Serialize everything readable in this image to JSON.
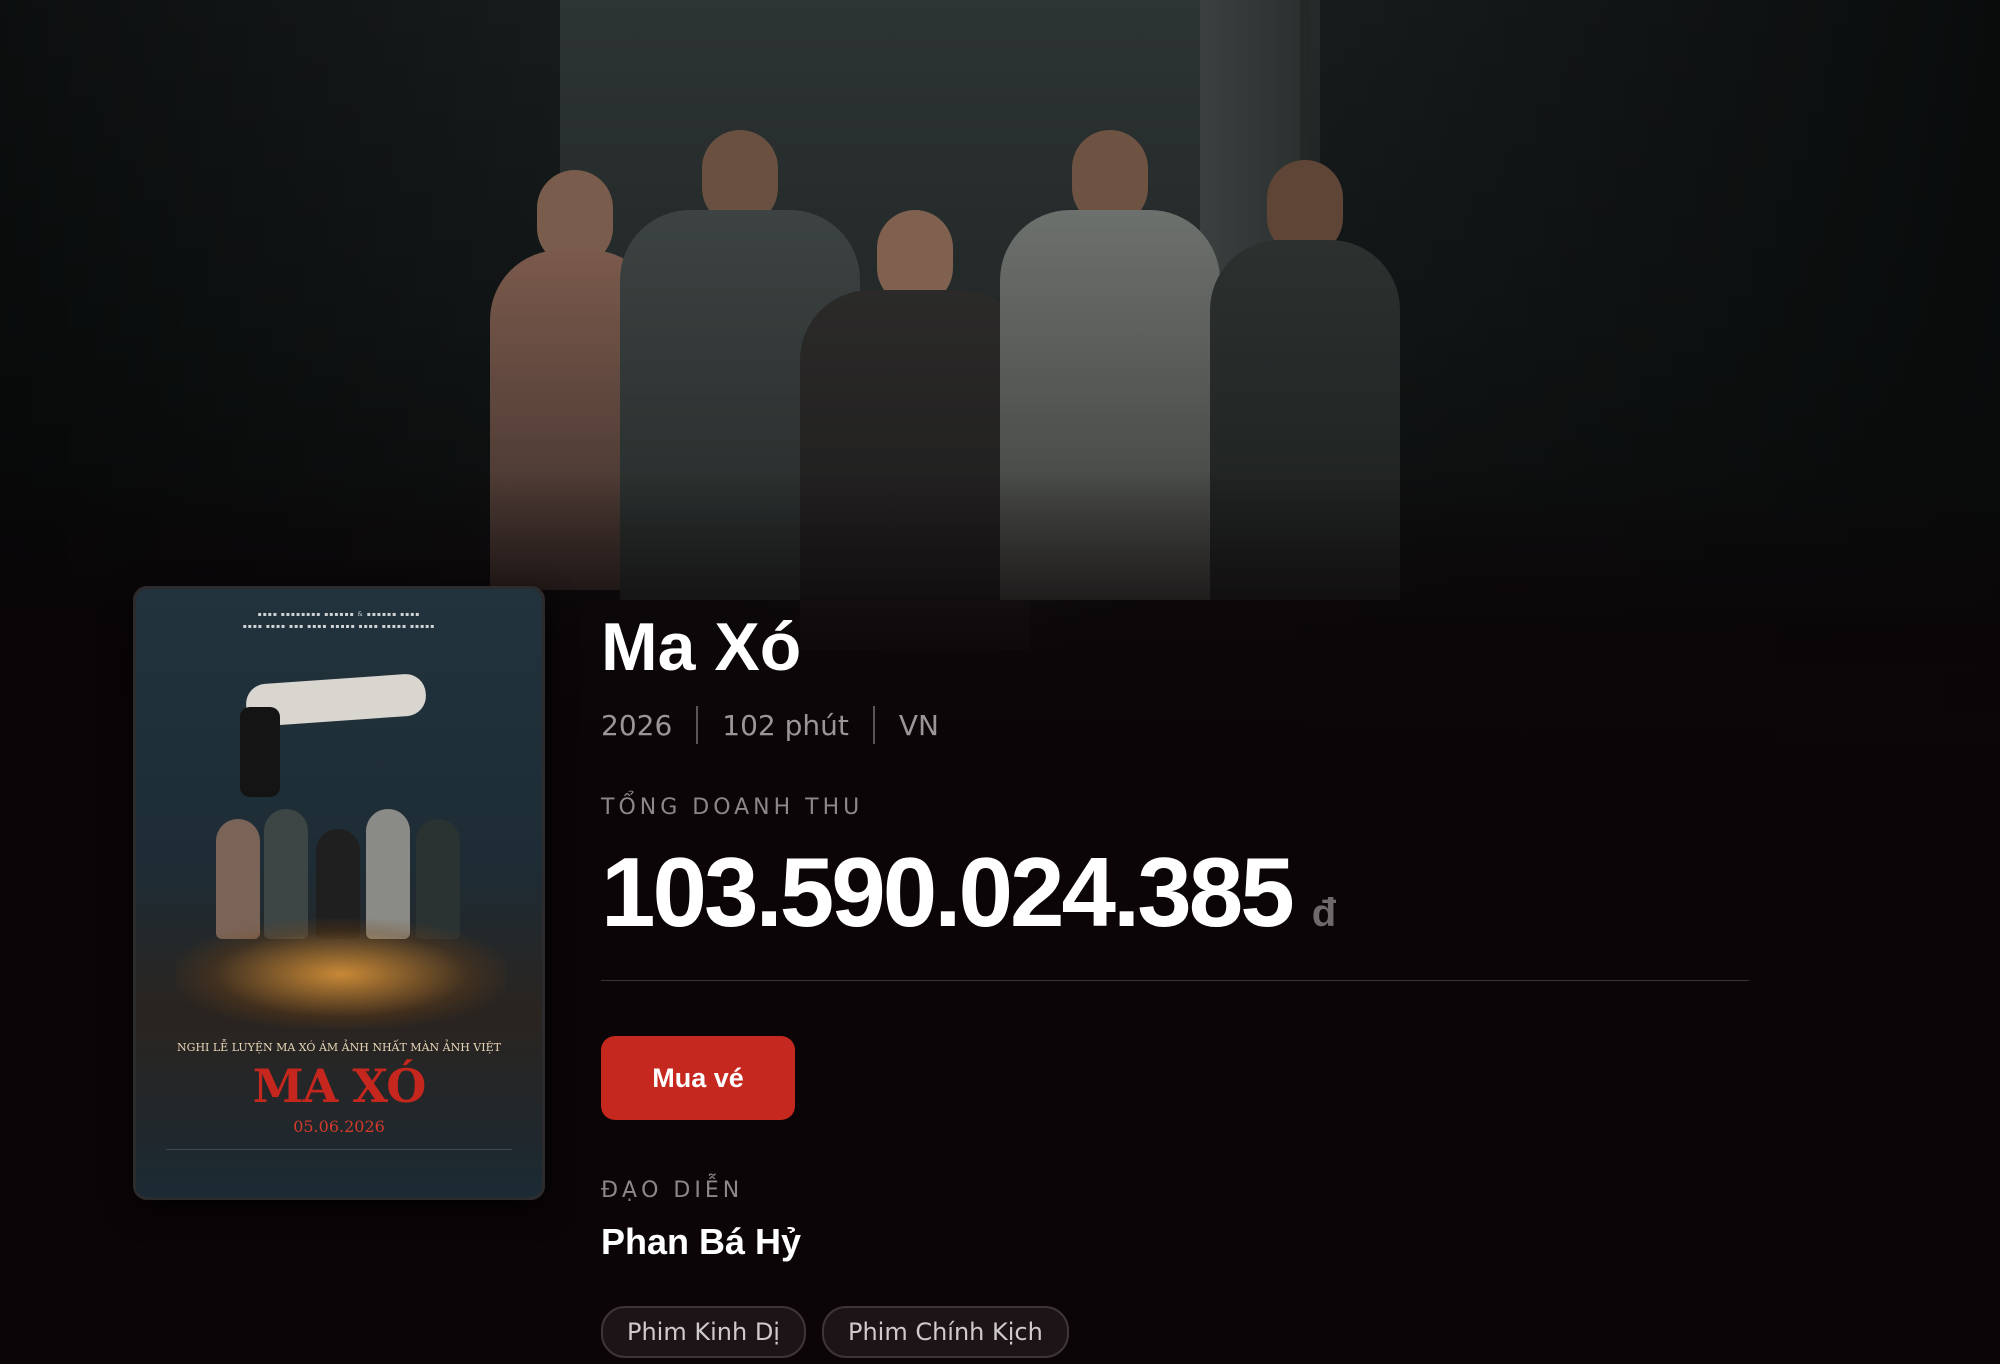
{
  "movie": {
    "title": "Ma Xó",
    "year": "2026",
    "duration": "102 phút",
    "country": "VN"
  },
  "revenue": {
    "label": "TỔNG DOANH THU",
    "amount": "103.590.024.385",
    "currency": "đ"
  },
  "actions": {
    "buy_label": "Mua vé"
  },
  "director": {
    "label": "ĐẠO DIỄN",
    "name": "Phan Bá Hỷ"
  },
  "genres": [
    "Phim Kinh Dị",
    "Phim Chính Kịch"
  ],
  "poster": {
    "tagline": "NGHI LỄ LUYỆN MA XÓ ÁM ẢNH NHẤT MÀN ẢNH VIỆT",
    "title": "MA XÓ",
    "date": "05.06.2026"
  },
  "colors": {
    "background": "#0b0507",
    "accent": "#c5281f",
    "muted_text": "#9a9698"
  }
}
